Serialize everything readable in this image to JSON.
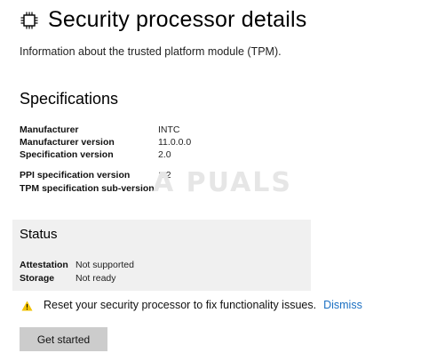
{
  "header": {
    "title": "Security processor details",
    "icon": "chip-icon"
  },
  "subtitle": "Information about the trusted platform module (TPM).",
  "specifications": {
    "title": "Specifications",
    "rows": [
      {
        "label": "Manufacturer",
        "value": "INTC"
      },
      {
        "label": "Manufacturer version",
        "value": "11.0.0.0"
      },
      {
        "label": "Specification version",
        "value": "2.0"
      },
      {
        "label": "PPI specification version",
        "value": "1.2"
      },
      {
        "label": "TPM specification sub-version",
        "value": ""
      }
    ]
  },
  "watermark": "A PUALS",
  "status": {
    "title": "Status",
    "rows": [
      {
        "label": "Attestation",
        "value": "Not supported"
      },
      {
        "label": "Storage",
        "value": "Not ready"
      }
    ]
  },
  "warning": {
    "icon": "warning-icon",
    "text": "Reset your security processor to fix functionality issues.",
    "dismiss_label": "Dismiss"
  },
  "actions": {
    "get_started_label": "Get started"
  },
  "colors": {
    "link": "#1a6fc2",
    "status_panel_bg": "#f0f0f0",
    "button_bg": "#cccccc",
    "warning_icon": "#f2c200"
  }
}
